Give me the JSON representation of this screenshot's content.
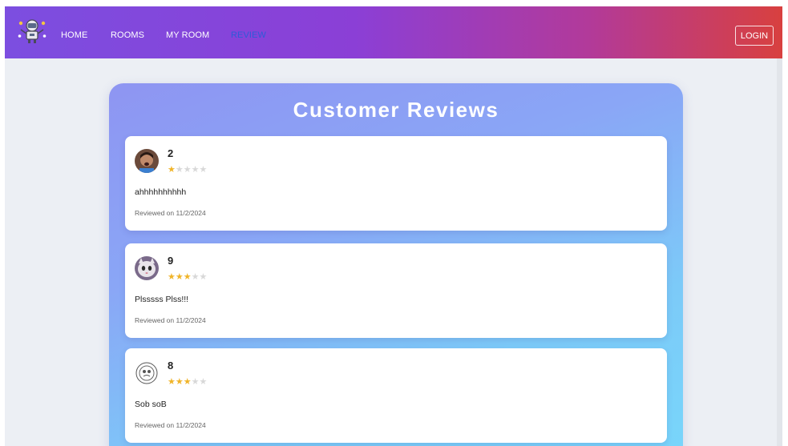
{
  "nav": {
    "links": [
      {
        "label": "HOME",
        "active": false
      },
      {
        "label": "ROOMS",
        "active": false
      },
      {
        "label": "MY ROOM",
        "active": false
      },
      {
        "label": "REVIEW",
        "active": true
      }
    ],
    "login_label": "LOGIN",
    "logo_icon": "astronaut-robot-icon"
  },
  "page": {
    "title": "Customer Reviews"
  },
  "reviews": [
    {
      "name": "2",
      "rating": 1,
      "max_rating": 5,
      "comment": "ahhhhhhhhhh",
      "date": "Reviewed on 11/2/2024",
      "avatar_icon": "person-avatar"
    },
    {
      "name": "9",
      "rating": 3,
      "max_rating": 5,
      "comment": "Plsssss Plss!!!",
      "date": "Reviewed on 11/2/2024",
      "avatar_icon": "cat-avatar"
    },
    {
      "name": "8",
      "rating": 3,
      "max_rating": 5,
      "comment": "Sob soB",
      "date": "Reviewed on 11/2/2024",
      "avatar_icon": "sketch-face-avatar"
    }
  ],
  "colors": {
    "star_on": "#f0b429",
    "star_off": "#d8d8d8",
    "active_nav": "#2d5bd8"
  }
}
